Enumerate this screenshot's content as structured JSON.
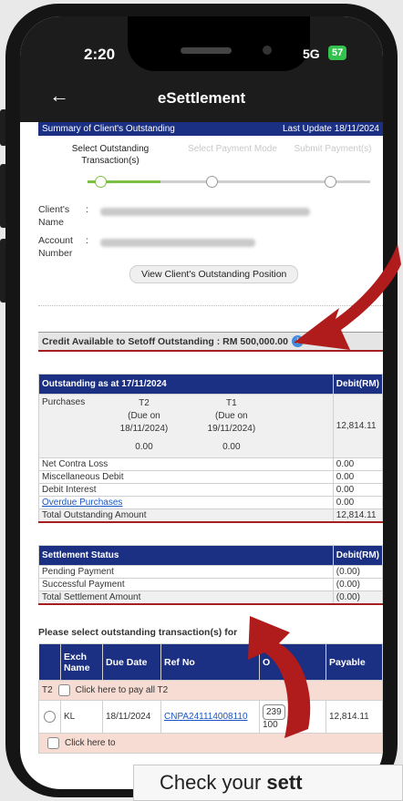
{
  "status": {
    "time": "2:20",
    "network": "5G",
    "battery": "57"
  },
  "app": {
    "title": "eSettlement",
    "back": "←"
  },
  "summary": {
    "title": "Summary of Client's Outstanding",
    "last_update": "Last Update 18/11/2024"
  },
  "steps": [
    "Select Outstanding Transaction(s)",
    "Select Payment Mode",
    "Submit Payment(s)"
  ],
  "client": {
    "name_label": "Client's Name",
    "account_label": "Account Number",
    "colon": ":",
    "view_button": "View Client's Outstanding Position"
  },
  "credit": {
    "text": "Credit Available to Setoff Outstanding : RM 500,000.00",
    "icon": "i"
  },
  "outstanding": {
    "header": "Outstanding as at 17/11/2024",
    "debit_header": "Debit(RM)",
    "purchases_label": "Purchases",
    "t2": {
      "label": "T2",
      "due": "(Due on 18/11/2024)",
      "value": "0.00"
    },
    "t1": {
      "label": "T1",
      "due": "(Due on 19/11/2024)",
      "value": "0.00"
    },
    "purchases_total": "12,814.11",
    "rows": [
      {
        "label": "Net Contra Loss",
        "value": "0.00"
      },
      {
        "label": "Miscellaneous Debit",
        "value": "0.00"
      },
      {
        "label": "Debit Interest",
        "value": "0.00"
      },
      {
        "label": "Overdue Purchases",
        "value": "0.00"
      }
    ],
    "total_label": "Total Outstanding Amount",
    "total_value": "12,814.11"
  },
  "settlement": {
    "header": "Settlement Status",
    "debit_header": "Debit(RM)",
    "rows": [
      {
        "label": "Pending Payment",
        "value": "(0.00)"
      },
      {
        "label": "Successful Payment",
        "value": "(0.00)"
      }
    ],
    "total_label": "Total Settlement Amount",
    "total_value": "(0.00)"
  },
  "select": {
    "prompt": "Please select outstanding transaction(s) for",
    "columns": [
      "Exch Name",
      "Due Date",
      "Ref No",
      "O",
      "Payable"
    ],
    "group": {
      "label": "T2",
      "text": "Click here to pay all T2"
    },
    "row": {
      "exch": "KL",
      "due": "18/11/2024",
      "ref": "CNPA241114008110",
      "qty": "239",
      "qty2": "100",
      "payable": "12,814.11"
    },
    "footer": "Click here to"
  },
  "banner": {
    "prefix": "Check your ",
    "bold": "sett"
  },
  "colors": {
    "navy": "#1b2f83",
    "arrow": "#b01c1c",
    "green": "#7ac143",
    "underline": "#a71e22"
  }
}
